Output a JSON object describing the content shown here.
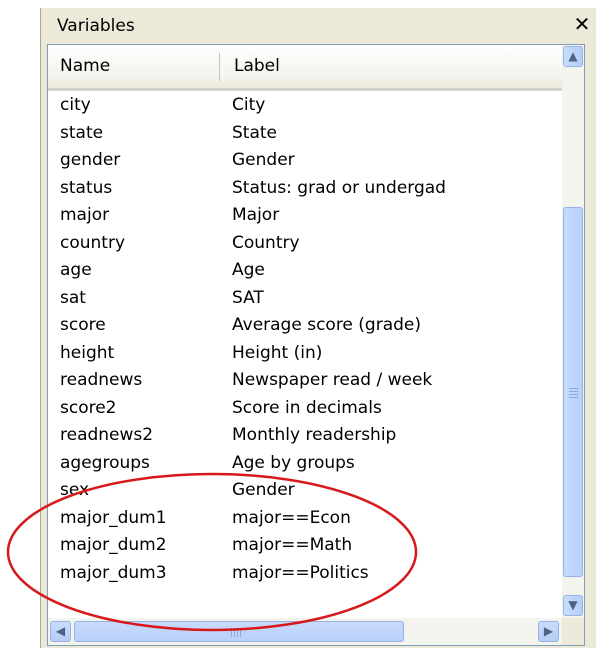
{
  "window": {
    "title": "Variables",
    "close_glyph": "✕"
  },
  "columns": {
    "name": "Name",
    "label": "Label"
  },
  "rows": [
    {
      "name": "city",
      "label": "City"
    },
    {
      "name": "state",
      "label": "State"
    },
    {
      "name": "gender",
      "label": "Gender"
    },
    {
      "name": "status",
      "label": "Status: grad or undergad"
    },
    {
      "name": "major",
      "label": "Major"
    },
    {
      "name": "country",
      "label": "Country"
    },
    {
      "name": "age",
      "label": "Age"
    },
    {
      "name": "sat",
      "label": "SAT"
    },
    {
      "name": "score",
      "label": "Average score (grade)"
    },
    {
      "name": "height",
      "label": "Height (in)"
    },
    {
      "name": "readnews",
      "label": "Newspaper read / week"
    },
    {
      "name": "score2",
      "label": "Score in decimals"
    },
    {
      "name": "readnews2",
      "label": "Monthly readership"
    },
    {
      "name": "agegroups",
      "label": "Age by groups"
    },
    {
      "name": "sex",
      "label": "Gender"
    },
    {
      "name": "major_dum1",
      "label": "major==Econ"
    },
    {
      "name": "major_dum2",
      "label": "major==Math"
    },
    {
      "name": "major_dum3",
      "label": "major==Politics"
    }
  ],
  "scrollbars": {
    "up_icon": "▲",
    "down_icon": "▼",
    "left_icon": "◀",
    "right_icon": "▶"
  },
  "colors": {
    "highlight_oval": "#d7191c"
  }
}
